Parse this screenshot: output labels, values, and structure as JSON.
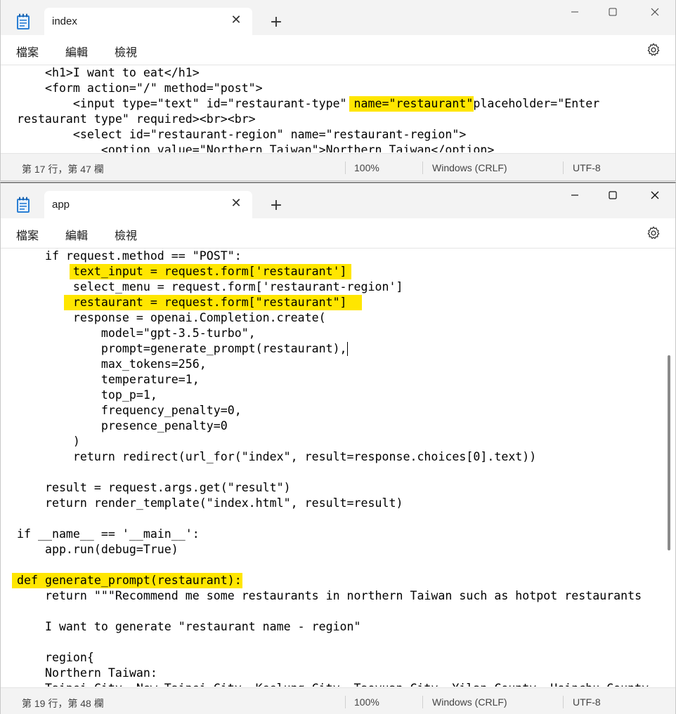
{
  "window1": {
    "tab_title": "index",
    "tab_close": "✕",
    "new_tab": "+",
    "menu": {
      "file": "檔案",
      "edit": "編輯",
      "view": "檢視"
    },
    "code_lines": [
      "    <h1>I want to eat</h1>",
      "    <form action=\"/\" method=\"post\">",
      "        <input type=\"text\" id=\"restaurant-type\" name=\"restaurant\"placeholder=\"Enter",
      "restaurant type\" required><br><br>",
      "        <select id=\"restaurant-region\" name=\"restaurant-region\">",
      "            <option value=\"Northern Taiwan\">Northern Taiwan</option>"
    ],
    "status": {
      "position": "第 17 行，第 47 欄",
      "zoom": "100%",
      "line_ending": "Windows (CRLF)",
      "encoding": "UTF-8"
    }
  },
  "window2": {
    "tab_title": "app",
    "tab_close": "✕",
    "new_tab": "+",
    "menu": {
      "file": "檔案",
      "edit": "編輯",
      "view": "檢視"
    },
    "code_lines": [
      "    if request.method == \"POST\":",
      "        text_input = request.form['restaurant']",
      "        select_menu = request.form['restaurant-region']",
      "        restaurant = request.form[\"restaurant\"]",
      "        response = openai.Completion.create(",
      "            model=\"gpt-3.5-turbo\",",
      "            prompt=generate_prompt(restaurant),",
      "            max_tokens=256,",
      "            temperature=1,",
      "            top_p=1,",
      "            frequency_penalty=0,",
      "            presence_penalty=0",
      "        )",
      "        return redirect(url_for(\"index\", result=response.choices[0].text))",
      "",
      "    result = request.args.get(\"result\")",
      "    return render_template(\"index.html\", result=result)",
      "",
      "if __name__ == '__main__':",
      "    app.run(debug=True)",
      "",
      "def generate_prompt(restaurant):",
      "    return \"\"\"Recommend me some restaurants in northern Taiwan such as hotpot restaurants",
      "",
      "    I want to generate \"restaurant name - region\"",
      "",
      "    region{",
      "    Northern Taiwan:",
      "    Taipei City, New Taipei City, Keelung City, Taoyuan City, Yilan County, Hsinchu County"
    ],
    "status": {
      "position": "第 19 行，第 48 欄",
      "zoom": "100%",
      "line_ending": "Windows (CRLF)",
      "encoding": "UTF-8"
    }
  },
  "colors": {
    "highlight": "#ffe600",
    "titlebar": "#f3f3f3"
  }
}
